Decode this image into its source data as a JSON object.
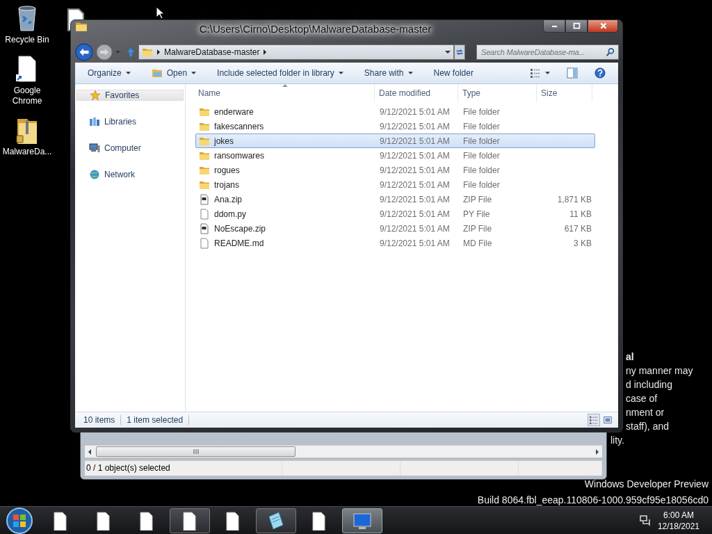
{
  "desktop_icons": [
    {
      "label": "Recycle Bin",
      "kind": "recycle-bin"
    },
    {
      "label": "Google Chrome",
      "kind": "shortcut"
    },
    {
      "label": "MalwareDa...",
      "kind": "zip-folder"
    }
  ],
  "desktop_text": [
    {
      "text": "al",
      "bold": true
    },
    {
      "text": "ny manner may",
      "bold": false
    },
    {
      "text": "d including",
      "bold": false
    },
    {
      "text": "case of",
      "bold": false
    },
    {
      "text": "nment or",
      "bold": false
    },
    {
      "text": "staff), and",
      "bold": false
    },
    {
      "text": "lity.",
      "bold": false
    }
  ],
  "build_info": [
    "Windows Developer Preview",
    "Build 8064.fbl_eeap.110806-1000.959cf95e18056cd0"
  ],
  "background_window": {
    "status": "0 / 1 object(s) selected"
  },
  "explorer": {
    "title": "C:\\Users\\Cirno\\Desktop\\MalwareDatabase-master",
    "address": [
      "MalwareDatabase-master"
    ],
    "search": {
      "placeholder": "Search MalwareDatabase-ma..."
    },
    "toolbar": [
      {
        "label": "Organize",
        "dropdown": true,
        "kind": "plain"
      },
      {
        "label": "Open",
        "dropdown": true,
        "kind": "open"
      },
      {
        "label": "Include selected folder in library",
        "dropdown": true,
        "kind": "plain"
      },
      {
        "label": "Share with",
        "dropdown": true,
        "kind": "plain"
      },
      {
        "label": "New folder",
        "dropdown": false,
        "kind": "plain"
      }
    ],
    "nav": [
      {
        "label": "Favorites",
        "kind": "favorites",
        "selected": true
      },
      {
        "label": "Libraries",
        "kind": "libraries",
        "selected": false
      },
      {
        "label": "Computer",
        "kind": "computer",
        "selected": false
      },
      {
        "label": "Network",
        "kind": "network",
        "selected": false
      }
    ],
    "columns": [
      "Name",
      "Date modified",
      "Type",
      "Size"
    ],
    "rows": [
      {
        "name": "enderware",
        "date": "9/12/2021 5:01 AM",
        "type": "File folder",
        "kind": "folder",
        "selected": false
      },
      {
        "name": "fakescanners",
        "date": "9/12/2021 5:01 AM",
        "type": "File folder",
        "kind": "folder",
        "selected": false
      },
      {
        "name": "jokes",
        "date": "9/12/2021 5:01 AM",
        "type": "File folder",
        "kind": "folder",
        "selected": true
      },
      {
        "name": "ransomwares",
        "date": "9/12/2021 5:01 AM",
        "type": "File folder",
        "kind": "folder",
        "selected": false
      },
      {
        "name": "rogues",
        "date": "9/12/2021 5:01 AM",
        "type": "File folder",
        "kind": "folder",
        "selected": false
      },
      {
        "name": "trojans",
        "date": "9/12/2021 5:01 AM",
        "type": "File folder",
        "kind": "folder",
        "selected": false
      },
      {
        "name": "Ana.zip",
        "date": "9/12/2021 5:01 AM",
        "type": "ZIP File",
        "size": "1,871 KB",
        "kind": "zip",
        "selected": false
      },
      {
        "name": "ddom.py",
        "date": "9/12/2021 5:01 AM",
        "type": "PY File",
        "size": "11 KB",
        "kind": "file",
        "selected": false
      },
      {
        "name": "NoEscape.zip",
        "date": "9/12/2021 5:01 AM",
        "type": "ZIP File",
        "size": "617 KB",
        "kind": "zip",
        "selected": false
      },
      {
        "name": "README.md",
        "date": "9/12/2021 5:01 AM",
        "type": "MD File",
        "size": "3 KB",
        "kind": "file",
        "selected": false
      }
    ],
    "status": [
      "10 items",
      "1 item selected"
    ]
  },
  "taskbar": {
    "buttons": [
      {
        "kind": "document",
        "running": false,
        "selected": false
      },
      {
        "kind": "document",
        "running": false,
        "selected": false
      },
      {
        "kind": "document",
        "running": false,
        "selected": false
      },
      {
        "kind": "document",
        "running": true,
        "selected": false
      },
      {
        "kind": "document",
        "running": false,
        "selected": false
      },
      {
        "kind": "notepad",
        "running": true,
        "selected": false
      },
      {
        "kind": "document",
        "running": false,
        "selected": false
      },
      {
        "kind": "screen",
        "running": true,
        "selected": true
      }
    ],
    "time": "6:00 AM",
    "date": "12/18/2021"
  }
}
